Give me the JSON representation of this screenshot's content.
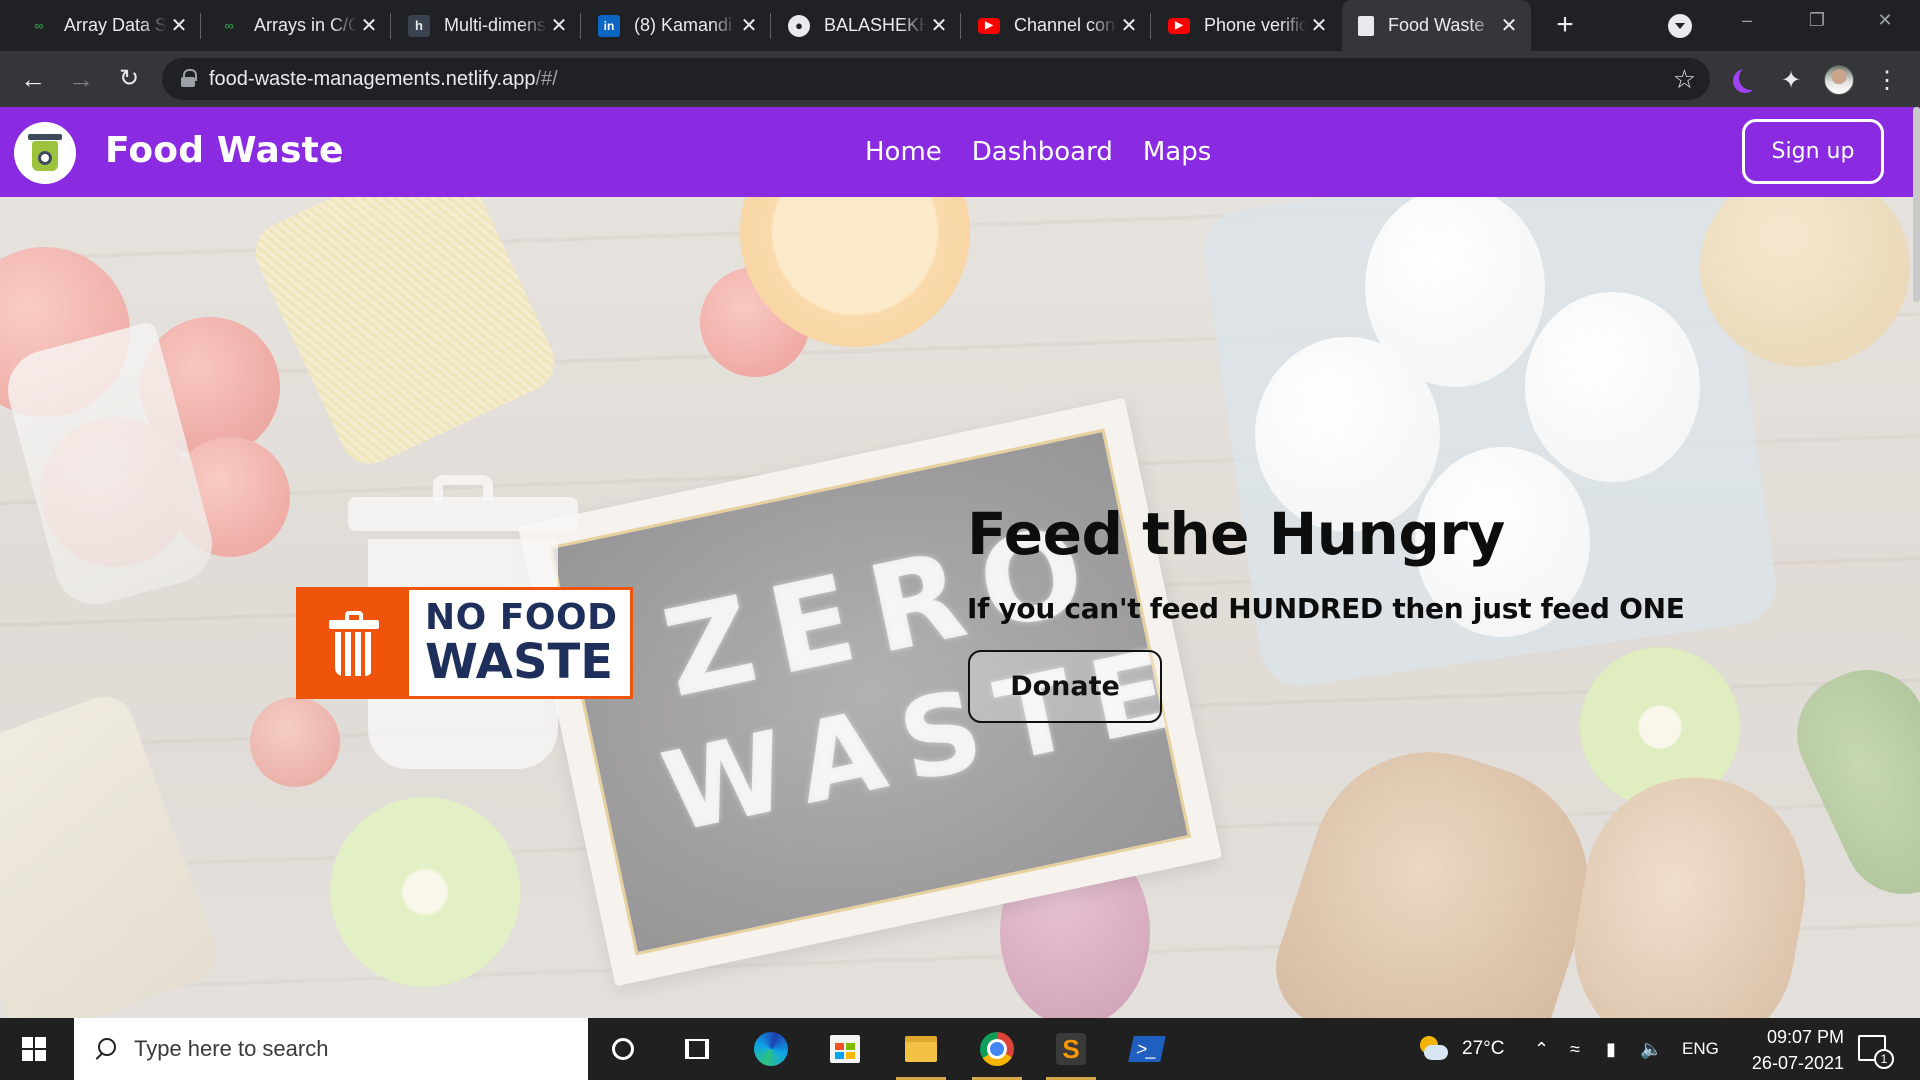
{
  "browser": {
    "tabs": [
      {
        "title": "Array Data Structure - GeeksforGeeks",
        "icon": "geeksforgeeks-icon",
        "favicon_color": "#2f8d46"
      },
      {
        "title": "Arrays in C/C++ - GeeksforGeeks",
        "icon": "geeksforgeeks-icon",
        "favicon_color": "#2f8d46"
      },
      {
        "title": "Multi-dimensional Arrays",
        "icon": "hackerrank-icon",
        "favicon_color": "#39424e"
      },
      {
        "title": "(8) Kamandi",
        "icon": "linkedin-icon",
        "favicon_color": "#0a66c2"
      },
      {
        "title": "BALASHEKHAR",
        "icon": "github-icon",
        "favicon_color": "#ffffff"
      },
      {
        "title": "Channel content",
        "icon": "youtube-icon",
        "favicon_color": "#ff0000"
      },
      {
        "title": "Phone verification",
        "icon": "youtube-icon",
        "favicon_color": "#ff0000"
      },
      {
        "title": "Food Waste",
        "icon": "page-favicon-icon",
        "favicon_color": "#e8eaed",
        "active": true
      }
    ],
    "new_tab_symbol": "+",
    "url_host": "food-waste-managements.netlify.app",
    "url_path": "/#/"
  },
  "site": {
    "brand": "Food Waste",
    "nav": [
      "Home",
      "Dashboard",
      "Maps"
    ],
    "signup_label": "Sign up",
    "accent_color": "#8a2be2"
  },
  "hero": {
    "logo_line1": "NO FOOD",
    "logo_line2": "WASTE",
    "chalk_line1": "ZERO",
    "chalk_line2": "WASTE",
    "title": "Feed the Hungry",
    "subtitle": "If you can't feed HUNDRED then just feed ONE",
    "donate_label": "Donate",
    "logo_color": "#f0540a"
  },
  "taskbar": {
    "search_placeholder": "Type here to search",
    "temperature": "27°C",
    "language": "ENG",
    "time": "09:07 PM",
    "date": "26-07-2021",
    "notification_count": "1"
  }
}
